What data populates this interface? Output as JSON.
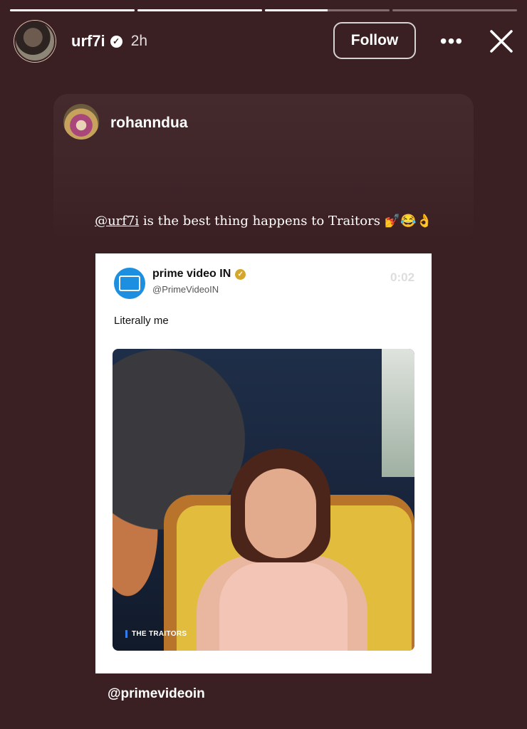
{
  "story": {
    "progress": [
      1.0,
      1.0,
      0.5,
      0.0
    ],
    "username": "urf7i",
    "time": "2h",
    "follow_label": "Follow",
    "icons": {
      "more": "more-icon",
      "close": "close-icon",
      "verified": "verified-badge-icon"
    }
  },
  "repost": {
    "username": "rohanndua",
    "caption_mention": "@urf7i",
    "caption_text": " is the best thing happens to Traitors 💅😂👌"
  },
  "tweet": {
    "name": "prime video IN",
    "handle": "@PrimeVideoIN",
    "timer": "0:02",
    "text": "Literally me",
    "video_label": "THE TRAITORS",
    "accent": "#1c8fe0"
  },
  "footer": {
    "mention": "@primevideoin"
  },
  "colors": {
    "background": "#3b2023",
    "text": "#ffffff"
  }
}
